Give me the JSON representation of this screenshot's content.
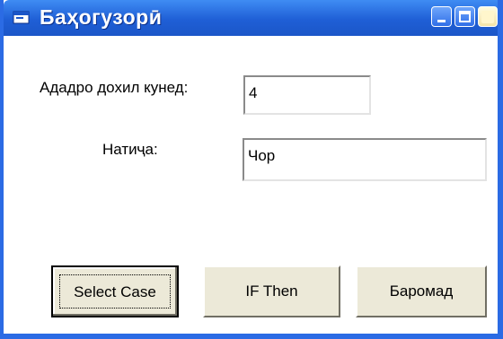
{
  "window": {
    "title": "Баҳогузорӣ",
    "controls": {
      "minimize_icon": "minimize-icon",
      "maximize_icon": "maximize-icon",
      "close_icon": "close-icon"
    },
    "colors": {
      "titlebar": "#1f5fd6",
      "frame": "#2b6be4",
      "button_face": "#ece9d8"
    }
  },
  "form": {
    "input_label": "Ададро дохил кунед:",
    "input_value": "4",
    "result_label": "Натиҷа:",
    "result_value": "Чор"
  },
  "buttons": {
    "select_case": "Select Case",
    "if_then": "IF Then",
    "exit": "Баромад"
  }
}
